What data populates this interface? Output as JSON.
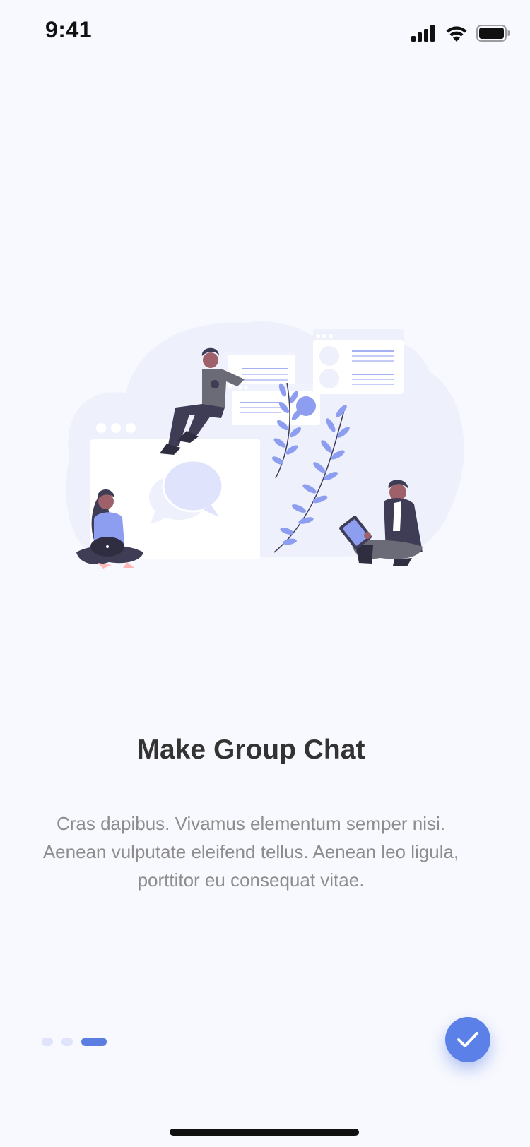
{
  "status_bar": {
    "time": "9:41",
    "icons": [
      "cellular-signal-icon",
      "wifi-icon",
      "battery-icon"
    ]
  },
  "illustration": {
    "name": "group-chat-illustration",
    "colors": {
      "accent": "#8d9ef0",
      "blob": "#eef0fc",
      "card": "#ffffff",
      "dark": "#3f3d56",
      "skin": "#9e616a"
    }
  },
  "onboarding": {
    "title": "Make Group Chat",
    "description": "Cras dapibus. Vivamus elementum semper nisi. Aenean vulputate eleifend tellus. Aenean leo ligula, porttitor eu consequat vitae.",
    "page_indicator": {
      "total_pages": 3,
      "current_page": 3
    },
    "next_button_icon": "checkmark-icon"
  },
  "colors": {
    "background": "#f8f9fe",
    "primary": "#5b80e8",
    "dot_inactive": "#dfe4fb",
    "title_text": "#333333",
    "body_text": "#8d8d8d"
  }
}
